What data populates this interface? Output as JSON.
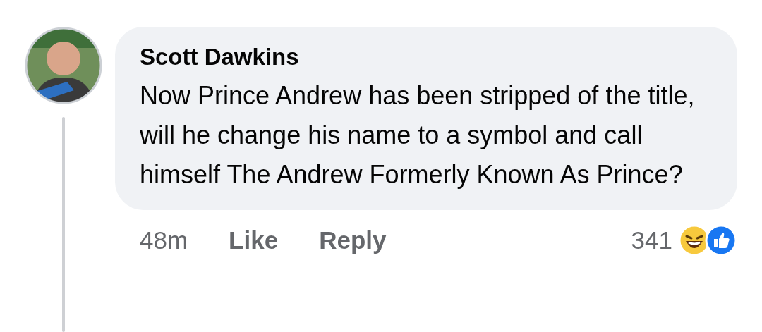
{
  "comment": {
    "author": "Scott Dawkins",
    "text": "Now Prince Andrew has been stripped of the title, will he change his name to a symbol and call himself The Andrew Formerly Known As Prince?",
    "time": "48m",
    "actions": [
      "Like",
      "Reply"
    ],
    "reaction_count": "341",
    "reactions": [
      {
        "kind": "haha"
      },
      {
        "kind": "like"
      }
    ]
  }
}
